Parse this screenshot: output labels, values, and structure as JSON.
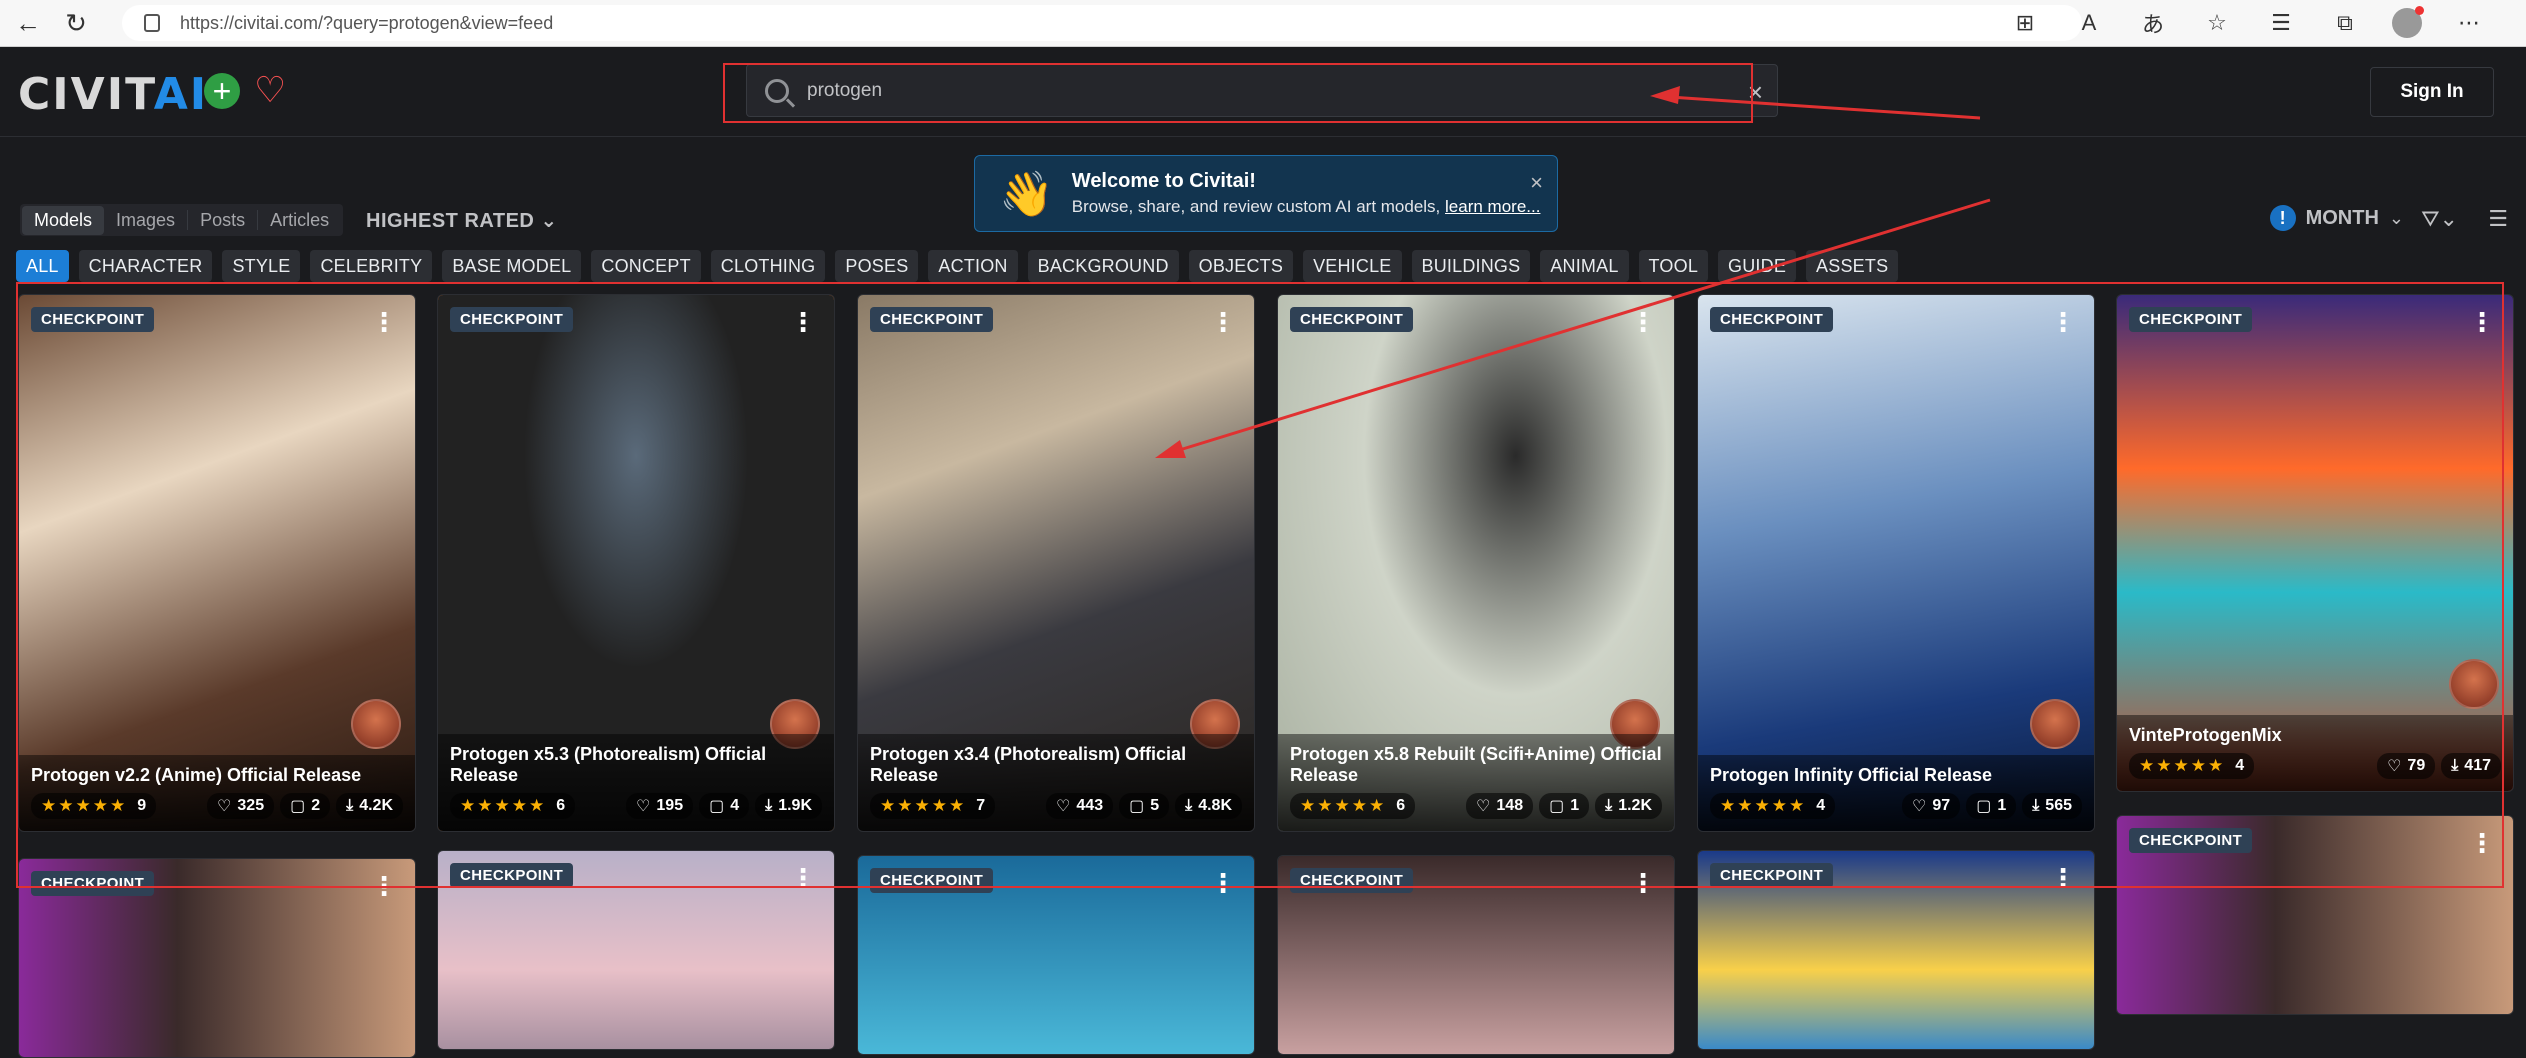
{
  "browser": {
    "url": "https://civitai.com/?query=protogen&view=feed"
  },
  "header": {
    "logo_main": "CIVIT",
    "logo_accent": "AI",
    "search_value": "protogen",
    "sign_in": "Sign In"
  },
  "welcome": {
    "title": "Welcome to Civitai!",
    "subtitle": "Browse, share, and review custom AI art models,",
    "link": "learn more..."
  },
  "subnav": {
    "items": [
      "Models",
      "Images",
      "Posts",
      "Articles"
    ],
    "active": "Models",
    "sort": "HIGHEST RATED",
    "period": "MONTH"
  },
  "tags": [
    "ALL",
    "CHARACTER",
    "STYLE",
    "CELEBRITY",
    "BASE MODEL",
    "CONCEPT",
    "CLOTHING",
    "POSES",
    "ACTION",
    "BACKGROUND",
    "OBJECTS",
    "VEHICLE",
    "BUILDINGS",
    "ANIMAL",
    "TOOL",
    "GUIDE",
    "ASSETS"
  ],
  "cards": [
    {
      "badge": "CHECKPOINT",
      "title": "Protogen v2.2 (Anime) Official Release",
      "rating_count": "9",
      "likes": "325",
      "comments": "2",
      "downloads": "4.2K",
      "stars": "★★★★★"
    },
    {
      "badge": "CHECKPOINT",
      "title": "Protogen x5.3 (Photorealism) Official Release",
      "rating_count": "6",
      "likes": "195",
      "comments": "4",
      "downloads": "1.9K",
      "stars": "★★★★★"
    },
    {
      "badge": "CHECKPOINT",
      "title": "Protogen x3.4 (Photorealism) Official Release",
      "rating_count": "7",
      "likes": "443",
      "comments": "5",
      "downloads": "4.8K",
      "stars": "★★★★★"
    },
    {
      "badge": "CHECKPOINT",
      "title": "Protogen x5.8 Rebuilt (Scifi+Anime) Official Release",
      "rating_count": "6",
      "likes": "148",
      "comments": "1",
      "downloads": "1.2K",
      "stars": "★★★★★"
    },
    {
      "badge": "CHECKPOINT",
      "title": "Protogen Infinity Official Release",
      "rating_count": "4",
      "likes": "97",
      "comments": "1",
      "downloads": "565",
      "stars": "★★★★★"
    },
    {
      "badge": "CHECKPOINT",
      "title": "VinteProtogenMix",
      "rating_count": "4",
      "likes": "79",
      "downloads": "417",
      "stars": "★★★★★"
    }
  ],
  "row2_badges": [
    "CHECKPOINT",
    "CHECKPOINT",
    "CHECKPOINT",
    "CHECKPOINT",
    "CHECKPOINT",
    "CHECKPOINT"
  ],
  "colors": {
    "accent": "#1c7ed6",
    "annotation": "#e03131",
    "star": "#fab005"
  }
}
